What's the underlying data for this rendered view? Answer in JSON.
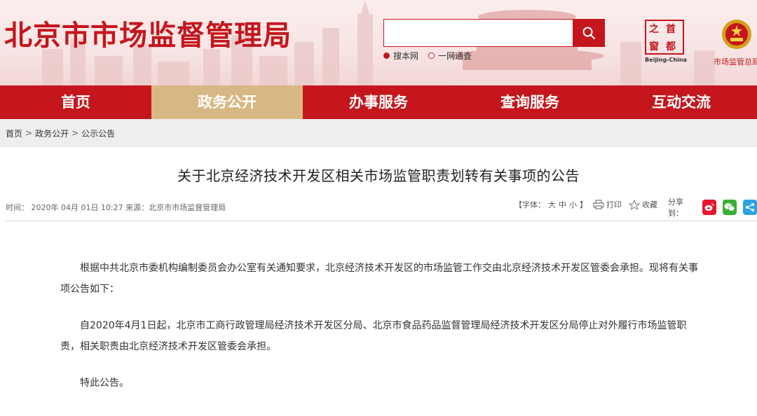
{
  "header": {
    "site_title": "北京市市场监督管理局",
    "search_placeholder": "",
    "search_options": [
      "搜本网",
      "一网通查"
    ],
    "capital_logo": {
      "chars": [
        "首",
        "都",
        "之",
        "窗"
      ],
      "en": "Beijing-China"
    },
    "agency_name": "市场监管总局",
    "emblem_icon": "national-emblem-icon",
    "search_icon": "search-icon"
  },
  "nav": {
    "items": [
      "首页",
      "政务公开",
      "办事服务",
      "查询服务",
      "互动交流"
    ],
    "active_index": 1
  },
  "breadcrumb": [
    "首页",
    "政务公开",
    "公示公告"
  ],
  "article": {
    "title": "关于北京经济技术开发区相关市场监管职责划转有关事项的公告",
    "meta": "时间： 2020年 04月 01日 10:27 来源：北京市市场监督管理局",
    "font_label": "【字体：",
    "font_sizes": [
      "大",
      "中",
      "小"
    ],
    "font_close": "】",
    "print_label": "打印",
    "favorite_label": "收藏",
    "share_label": "分享到：",
    "paragraphs": [
      "根据中共北京市委机构编制委员会办公室有关通知要求，北京经济技术开发区的市场监管工作交由北京经济技术开发区管委会承担。现将有关事项公告如下：",
      "自2020年4月1日起，北京市工商行政管理局经济技术开发区分局、北京市食品药品监督管理局经济技术开发区分局停止对外履行市场监管职责，相关职责由北京经济技术开发区管委会承担。",
      "特此公告。"
    ]
  },
  "colors": {
    "brand_red": "#c4161c",
    "nav_active": "#d7b884",
    "weibo": "#e6162d",
    "wechat": "#3cb034",
    "share_generic": "#2ba3e0"
  }
}
